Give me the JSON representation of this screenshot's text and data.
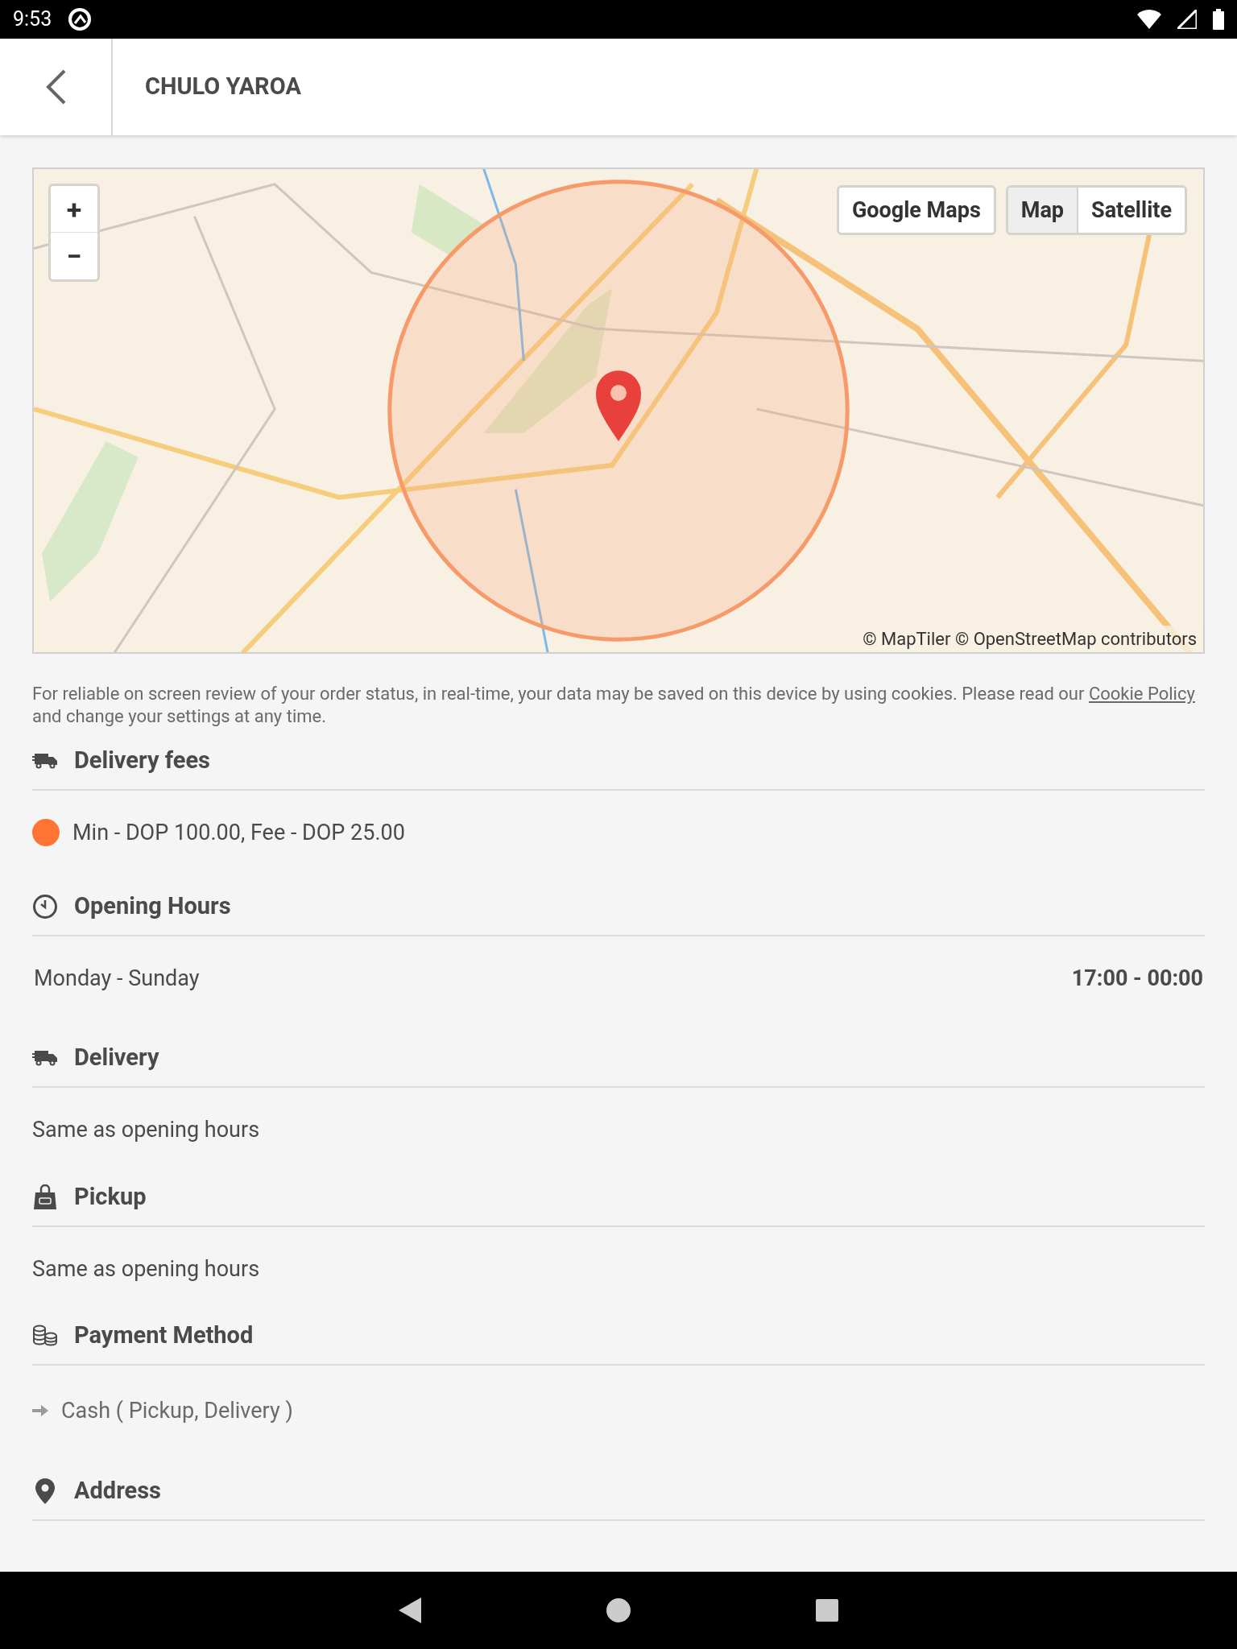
{
  "status_bar": {
    "time": "9:53"
  },
  "header": {
    "title": "CHULO YAROA"
  },
  "map": {
    "zoom_in": "+",
    "zoom_out": "−",
    "link_button": "Google Maps",
    "map_types": [
      {
        "label": "Map",
        "selected": true
      },
      {
        "label": "Satellite",
        "selected": false
      }
    ],
    "attribution": "© MapTiler © OpenStreetMap contributors"
  },
  "cookie_notice": {
    "text_before": "For reliable on screen review of your order status, in real-time, your data may be saved on this device by using cookies. Please read our",
    "link": "Cookie Policy",
    "text_after": "and change your settings at any time."
  },
  "sections": [
    {
      "kind": "fees",
      "title": "Delivery fees",
      "items": [
        {
          "text": "Min - DOP 100.00, Fee - DOP 25.00",
          "color": "#ff7433"
        }
      ]
    },
    {
      "kind": "hours",
      "title": "Opening Hours",
      "rows": [
        {
          "days": "Monday - Sunday",
          "hours": "17:00 - 00:00"
        }
      ]
    },
    {
      "kind": "delivery",
      "title": "Delivery",
      "text": "Same as opening hours"
    },
    {
      "kind": "pickup",
      "title": "Pickup",
      "text": "Same as opening hours"
    },
    {
      "kind": "payment",
      "title": "Payment Method",
      "items": [
        "Cash ( Pickup, Delivery )"
      ]
    },
    {
      "kind": "address",
      "title": "Address"
    }
  ]
}
